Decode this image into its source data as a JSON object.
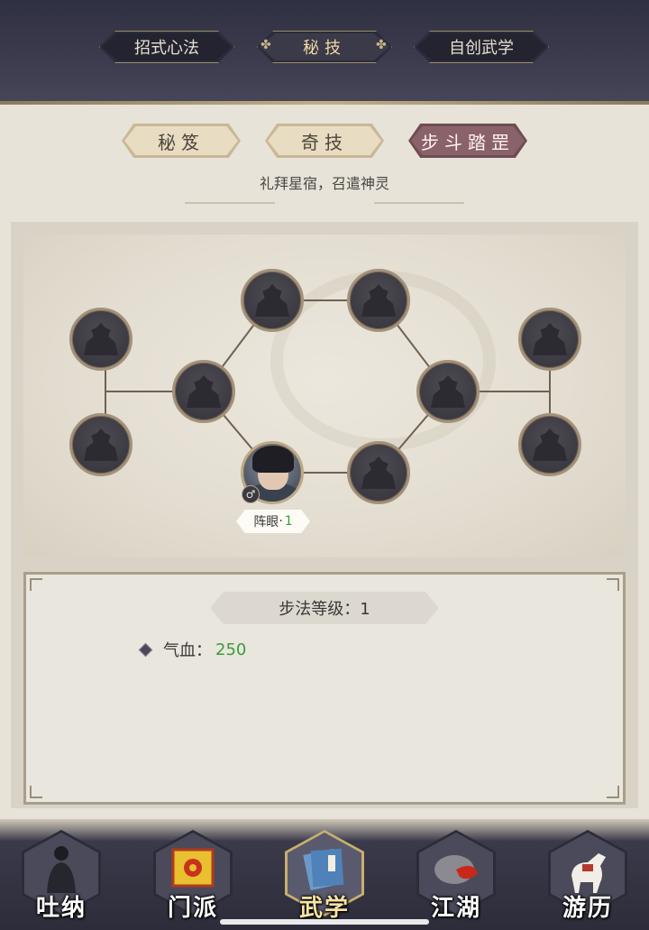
{
  "top_tabs": [
    {
      "label": "招式心法",
      "active": false
    },
    {
      "label": "秘技",
      "active": true
    },
    {
      "label": "自创武学",
      "active": false
    }
  ],
  "sub_tabs": [
    {
      "label": "秘笈",
      "active": false
    },
    {
      "label": "奇技",
      "active": false
    },
    {
      "label": "步斗踏罡",
      "active": true
    }
  ],
  "motto": "礼拜星宿，召遣神灵",
  "formation": {
    "eye_label": "阵眼",
    "eye_level": "1",
    "hero_gender_icon": "male-symbol-icon"
  },
  "info": {
    "level_label": "步法等级：1",
    "stat_label": "气血：",
    "stat_value": "250"
  },
  "bottom_nav": [
    {
      "label": "吐纳",
      "icon": "meditating-figure-icon",
      "active": false
    },
    {
      "label": "门派",
      "icon": "sect-banner-icon",
      "active": false
    },
    {
      "label": "武学",
      "icon": "martial-book-icon",
      "active": true
    },
    {
      "label": "江湖",
      "icon": "bamboo-hat-icon",
      "active": false
    },
    {
      "label": "游历",
      "icon": "white-horse-icon",
      "active": false
    }
  ],
  "colors": {
    "accent_gold": "#c9ae6e",
    "active_tab": "#8a6269",
    "stat_green": "#3f9a3a",
    "node_dark": "#3b3941"
  }
}
